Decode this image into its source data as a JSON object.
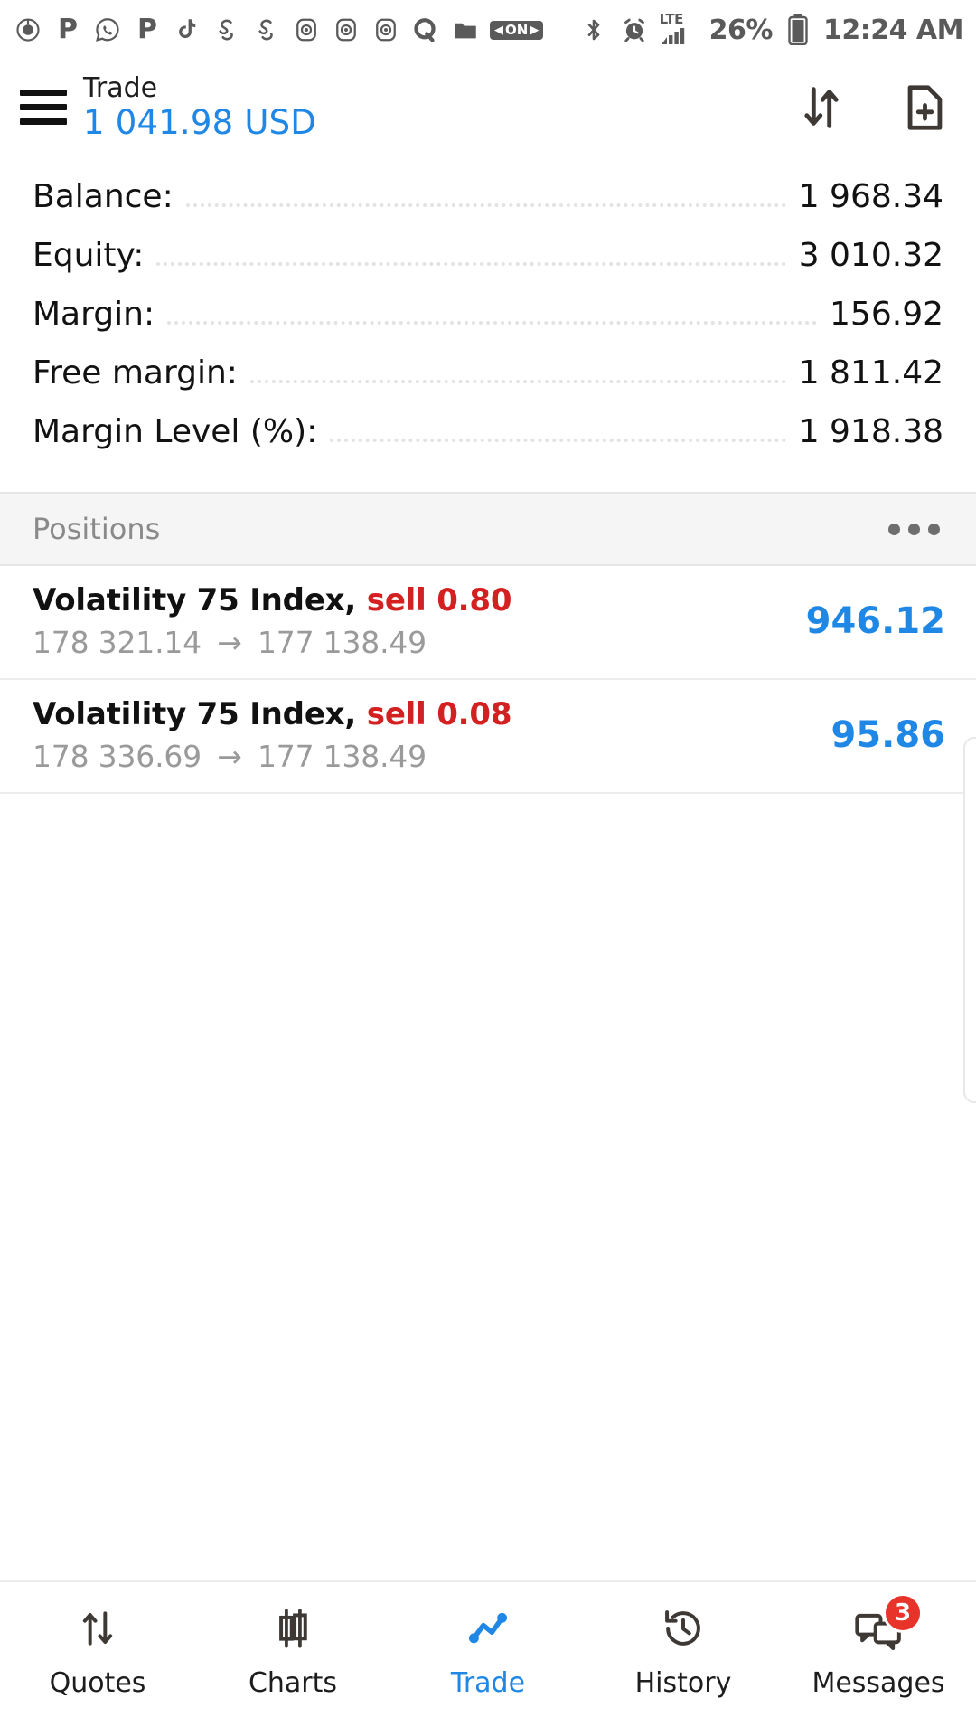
{
  "status_bar": {
    "app_icons": [
      {
        "name": "music-app-icon",
        "glyph": "◉"
      },
      {
        "name": "pinterest-icon",
        "glyph": "P"
      },
      {
        "name": "whatsapp-icon",
        "glyph": "✆"
      },
      {
        "name": "pinterest-alt-icon",
        "glyph": "P"
      },
      {
        "name": "tiktok-icon",
        "glyph": "♪"
      },
      {
        "name": "snapchat-icon",
        "glyph": "S"
      },
      {
        "name": "snapchat-alt-icon",
        "glyph": "S"
      },
      {
        "name": "instagram-icon",
        "glyph": "◙"
      },
      {
        "name": "instagram-alt-icon",
        "glyph": "◙"
      },
      {
        "name": "instagram-third-icon",
        "glyph": "◙"
      },
      {
        "name": "quora-icon",
        "glyph": "Q"
      },
      {
        "name": "folder-icon",
        "glyph": "▰"
      }
    ],
    "on_badge": "ON",
    "bluetooth": "bluetooth-icon",
    "alarm": "alarm-icon",
    "network_type": "LTE",
    "signal": "signal-bars-icon",
    "battery_percent": "26%",
    "battery_icon": "battery-icon",
    "time": "12:24 AM"
  },
  "header": {
    "menu_icon": "hamburger-menu-icon",
    "title": "Trade",
    "account_value": "1 041.98 USD",
    "sort_icon": "sort-arrows-icon",
    "new_order_icon": "new-order-icon"
  },
  "summary": {
    "rows": [
      {
        "label": "Balance:",
        "value": "1 968.34"
      },
      {
        "label": "Equity:",
        "value": "3 010.32"
      },
      {
        "label": "Margin:",
        "value": "156.92"
      },
      {
        "label": "Free margin:",
        "value": "1 811.42"
      },
      {
        "label": "Margin Level (%):",
        "value": "1 918.38"
      }
    ]
  },
  "positions_section": {
    "title": "Positions",
    "more_icon": "more-options-icon",
    "rows": [
      {
        "symbol": "Volatility 75 Index,",
        "side": "sell 0.80",
        "open_price": "178 321.14",
        "arrow": "→",
        "current_price": "177 138.49",
        "profit": "946.12"
      },
      {
        "symbol": "Volatility 75 Index,",
        "side": "sell 0.08",
        "open_price": "178 336.69",
        "arrow": "→",
        "current_price": "177 138.49",
        "profit": "95.86"
      }
    ]
  },
  "bottom_nav": {
    "items": [
      {
        "label": "Quotes",
        "icon": "quotes-arrows-icon",
        "active": false,
        "badge": ""
      },
      {
        "label": "Charts",
        "icon": "candlestick-chart-icon",
        "active": false,
        "badge": ""
      },
      {
        "label": "Trade",
        "icon": "trade-line-icon",
        "active": true,
        "badge": ""
      },
      {
        "label": "History",
        "icon": "history-clock-icon",
        "active": false,
        "badge": ""
      },
      {
        "label": "Messages",
        "icon": "messages-chat-icon",
        "active": false,
        "badge": "3"
      }
    ]
  },
  "colors": {
    "accent_blue": "#1f87e5",
    "sell_red": "#d32020",
    "badge_red": "#e8332a",
    "muted_grey": "#9a9a9a"
  }
}
